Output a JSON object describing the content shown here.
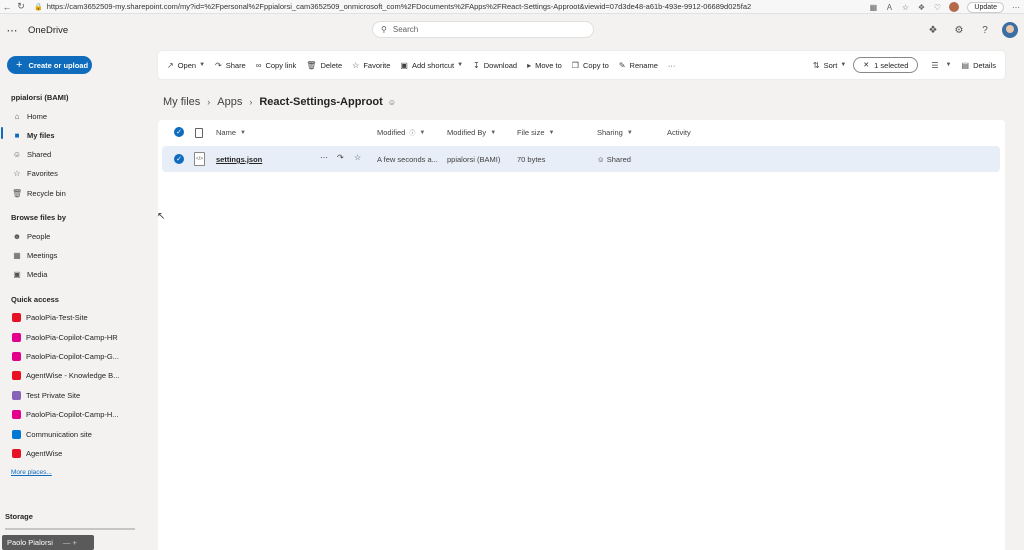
{
  "browser": {
    "url": "https://cam3652509-my.sharepoint.com/my?id=%2Fpersonal%2Fppialorsi_cam3652509_onmicrosoft_com%2FDocuments%2FApps%2FReact-Settings-Approot&viewid=07d3de48-a61b-493e-9912-06689d025fa2",
    "update_label": "Update"
  },
  "header": {
    "brand": "OneDrive",
    "search_placeholder": "Search"
  },
  "sidebar": {
    "create_label": "Create or upload",
    "user_heading": "ppialorsi (BAMI)",
    "main_items": [
      {
        "label": "Home",
        "icon": "home-icon"
      },
      {
        "label": "My files",
        "icon": "folder-icon"
      },
      {
        "label": "Shared",
        "icon": "shared-icon"
      },
      {
        "label": "Favorites",
        "icon": "star-icon"
      },
      {
        "label": "Recycle bin",
        "icon": "recycle-bin-icon"
      }
    ],
    "browse_heading": "Browse files by",
    "browse_items": [
      {
        "label": "People"
      },
      {
        "label": "Meetings"
      },
      {
        "label": "Media"
      }
    ],
    "quick_heading": "Quick access",
    "quick_items": [
      {
        "label": "PaoloPia-Test-Site",
        "color": "#e81123"
      },
      {
        "label": "PaoloPia-Copilot-Camp-HR",
        "color": "#e3008c"
      },
      {
        "label": "PaoloPia-Copilot-Camp-G...",
        "color": "#e3008c"
      },
      {
        "label": "AgentWise - Knowledge B...",
        "color": "#e81123"
      },
      {
        "label": "Test Private Site",
        "color": "#8764b8"
      },
      {
        "label": "PaoloPia-Copilot-Camp-H...",
        "color": "#e3008c"
      },
      {
        "label": "Communication site",
        "color": "#0078d4"
      },
      {
        "label": "AgentWise",
        "color": "#e81123"
      }
    ],
    "more_places": "More places...",
    "storage_heading": "Storage",
    "taskbar_label": "Paolo Pialorsi"
  },
  "commands": {
    "open": "Open",
    "share": "Share",
    "copy_link": "Copy link",
    "delete": "Delete",
    "favorite": "Favorite",
    "add_shortcut": "Add shortcut",
    "download": "Download",
    "move_to": "Move to",
    "copy_to": "Copy to",
    "rename": "Rename",
    "more": "···",
    "sort": "Sort",
    "selected": "1 selected",
    "details": "Details"
  },
  "breadcrumb": {
    "root": "My files",
    "mid": "Apps",
    "current": "React-Settings-Approot"
  },
  "columns": {
    "name": "Name",
    "modified": "Modified",
    "modified_by": "Modified By",
    "file_size": "File size",
    "sharing": "Sharing",
    "activity": "Activity"
  },
  "files": [
    {
      "name": "settings.json",
      "modified": "A few seconds a...",
      "modified_by": "ppialorsi (BAMI)",
      "file_size": "70 bytes",
      "sharing": "Shared"
    }
  ],
  "colors": {
    "accent": "#0f6cbd",
    "selected_row": "#e7eef8"
  }
}
